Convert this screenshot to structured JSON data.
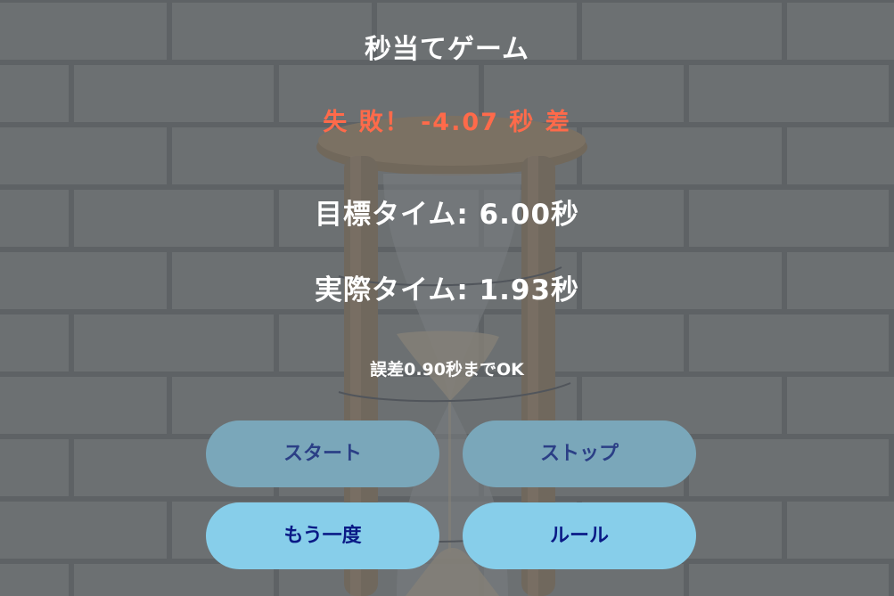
{
  "game": {
    "title": "秒当てゲーム",
    "result_text": "失 敗！ -4.07 秒 差",
    "target_time_text": "目標タイム: 6.00秒",
    "actual_time_text": "実際タイム: 1.93秒",
    "tolerance_text": "誤差0.90秒までOK"
  },
  "buttons": {
    "start": "スタート",
    "stop": "ストップ",
    "retry": "もう一度",
    "rules": "ルール"
  },
  "colors": {
    "result_fail": "#ff6a4a",
    "button_active_bg": "#87ceea",
    "button_disabled_bg": "#7aa7ba",
    "button_active_text": "#0a1a86",
    "button_disabled_text": "#2b3f86"
  },
  "background": {
    "image_subject": "hourglass-in-front-of-brick-wall"
  }
}
